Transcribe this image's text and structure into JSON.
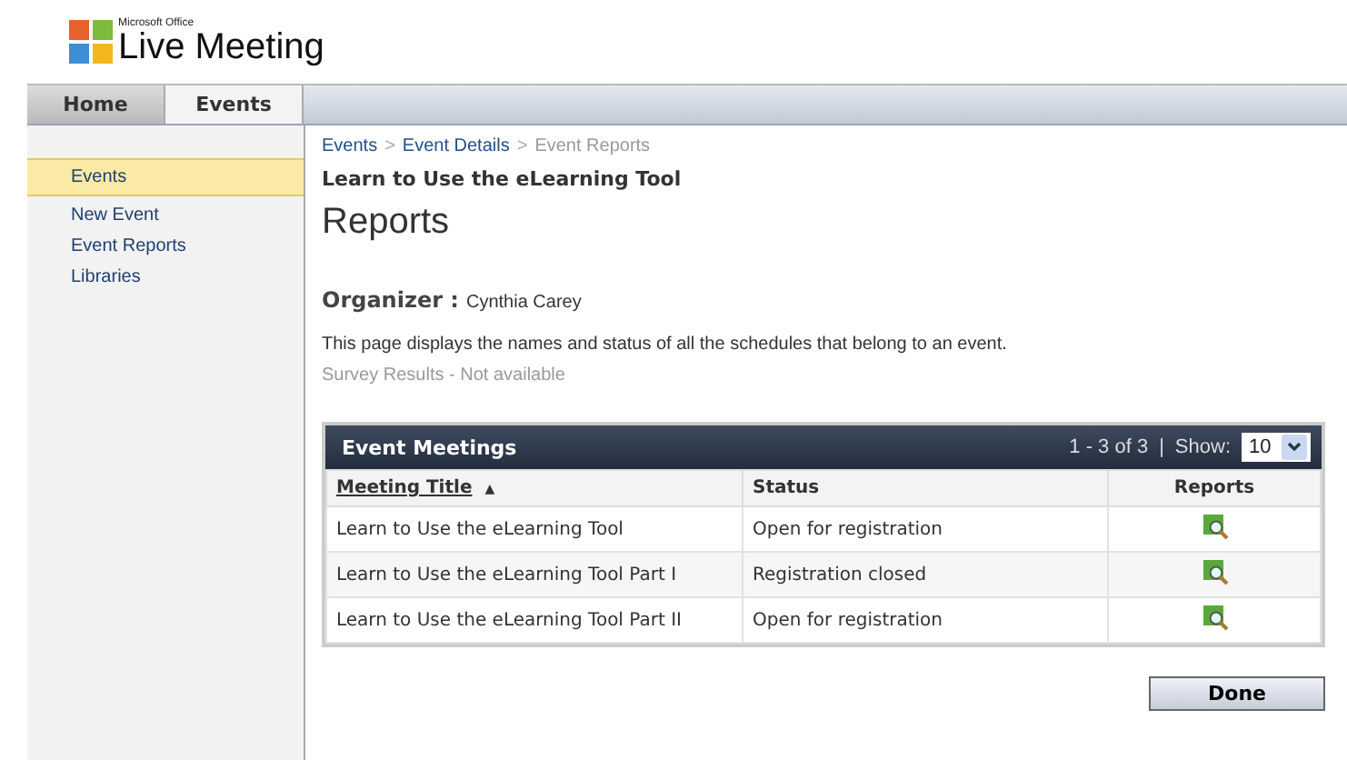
{
  "logo": {
    "small": "Microsoft Office",
    "big": "Live Meeting"
  },
  "tabs": [
    {
      "label": "Home",
      "selected": false
    },
    {
      "label": "Events",
      "selected": true
    }
  ],
  "sidebar": {
    "items": [
      {
        "label": "Events",
        "selected": true
      },
      {
        "label": "New Event",
        "selected": false
      },
      {
        "label": "Event Reports",
        "selected": false
      },
      {
        "label": "Libraries",
        "selected": false
      }
    ]
  },
  "breadcrumb": [
    {
      "label": "Events",
      "current": false
    },
    {
      "label": "Event Details",
      "current": false
    },
    {
      "label": "Event Reports",
      "current": true
    }
  ],
  "breadcrumb_separator": ">",
  "event_title": "Learn to Use the eLearning Tool",
  "page_title": "Reports",
  "organizer": {
    "label": "Organizer :",
    "value": "Cynthia Carey"
  },
  "description": "This page displays the names and status of all the schedules that belong to an event.",
  "survey_results": "Survey Results - Not available",
  "table": {
    "title": "Event Meetings",
    "range": "1 - 3 of 3",
    "separator": "|",
    "show_label": "Show:",
    "show_value": "10",
    "columns": [
      {
        "label": "Meeting Title",
        "sort": "▲"
      },
      {
        "label": "Status"
      },
      {
        "label": "Reports"
      }
    ],
    "rows": [
      {
        "title": "Learn to Use the eLearning Tool",
        "status": "Open for registration"
      },
      {
        "title": "Learn to Use the eLearning Tool Part I",
        "status": "Registration closed"
      },
      {
        "title": "Learn to Use the eLearning Tool Part II",
        "status": "Open for registration"
      }
    ]
  },
  "buttons": [
    "Done"
  ]
}
